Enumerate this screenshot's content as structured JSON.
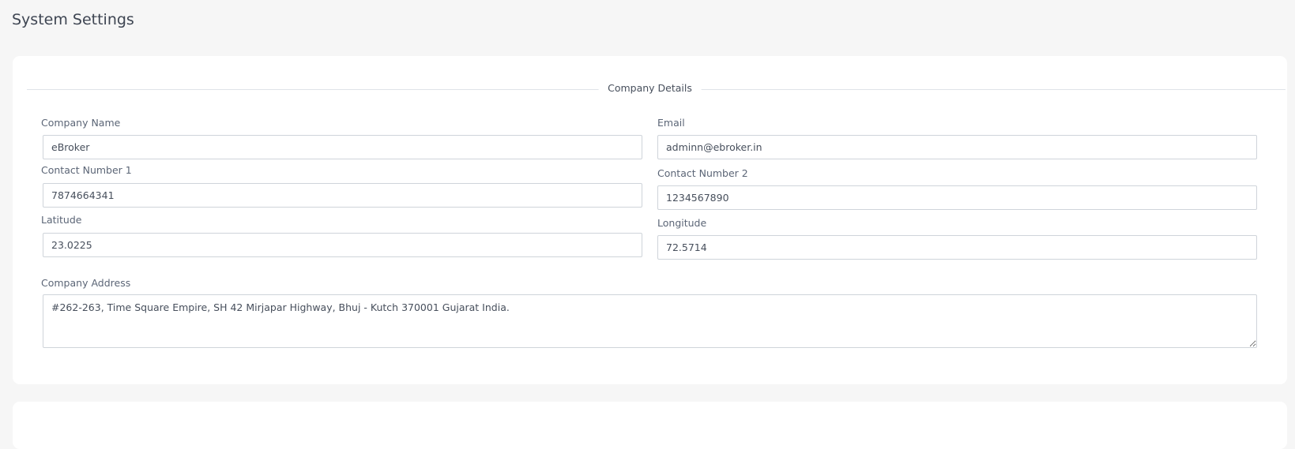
{
  "page": {
    "title": "System Settings"
  },
  "company_details": {
    "section_title": "Company Details",
    "company_name": {
      "label": "Company Name",
      "value": "eBroker"
    },
    "email": {
      "label": "Email",
      "value": "adminn@ebroker.in"
    },
    "contact_number_1": {
      "label": "Contact Number 1",
      "value": "7874664341"
    },
    "contact_number_2": {
      "label": "Contact Number 2",
      "value": "1234567890"
    },
    "latitude": {
      "label": "Latitude",
      "value": "23.0225"
    },
    "longitude": {
      "label": "Longitude",
      "value": "72.5714"
    },
    "company_address": {
      "label": "Company Address",
      "value": "#262-263, Time Square Empire, SH 42 Mirjapar Highway, Bhuj - Kutch 370001 Gujarat India."
    }
  },
  "colors": {
    "background": "#f6f6f6",
    "card": "#ffffff",
    "input_border": "#cfd4da",
    "label_text": "#5b6576",
    "title_text": "#3e4552"
  }
}
